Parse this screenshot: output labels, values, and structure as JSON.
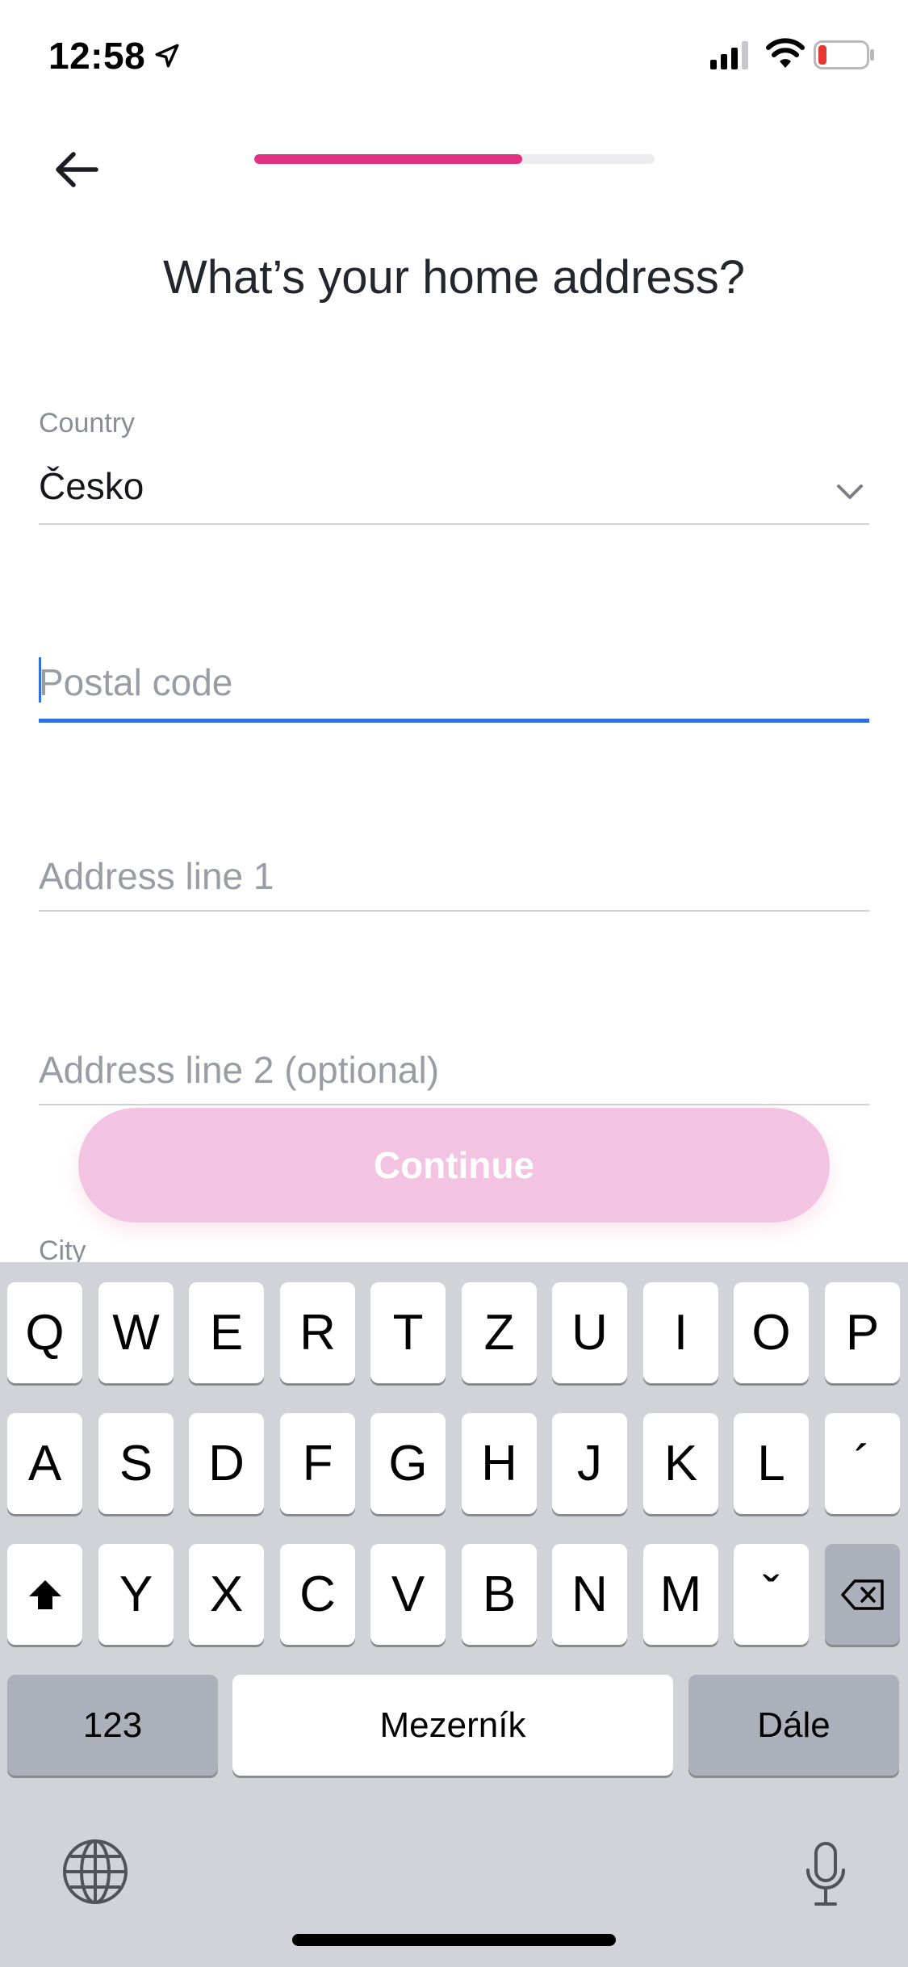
{
  "status_bar": {
    "time": "12:58",
    "battery_color": "#e53935"
  },
  "header": {
    "progress_fraction": 0.67,
    "accent_color": "#e0307f"
  },
  "page": {
    "title": "What’s your home address?"
  },
  "form": {
    "country": {
      "label": "Country",
      "value": "Česko"
    },
    "postal_code": {
      "value": "",
      "placeholder": "Postal code"
    },
    "address_line_1": {
      "value": "",
      "placeholder": "Address line 1"
    },
    "address_line_2": {
      "value": "",
      "placeholder": "Address line 2 (optional)"
    },
    "city": {
      "label": "City"
    }
  },
  "actions": {
    "continue_label": "Continue"
  },
  "keyboard": {
    "row1": [
      "Q",
      "W",
      "E",
      "R",
      "T",
      "Z",
      "U",
      "I",
      "O",
      "P"
    ],
    "row2": [
      "A",
      "S",
      "D",
      "F",
      "G",
      "H",
      "J",
      "K",
      "L",
      "´"
    ],
    "row3": [
      "Y",
      "X",
      "C",
      "V",
      "B",
      "N",
      "M",
      "ˇ"
    ],
    "numbers_label": "123",
    "space_label": "Mezerník",
    "return_label": "Dále",
    "shift_icon": "shift-icon",
    "delete_icon": "backspace-icon",
    "globe_icon": "globe-icon",
    "mic_icon": "microphone-icon"
  }
}
